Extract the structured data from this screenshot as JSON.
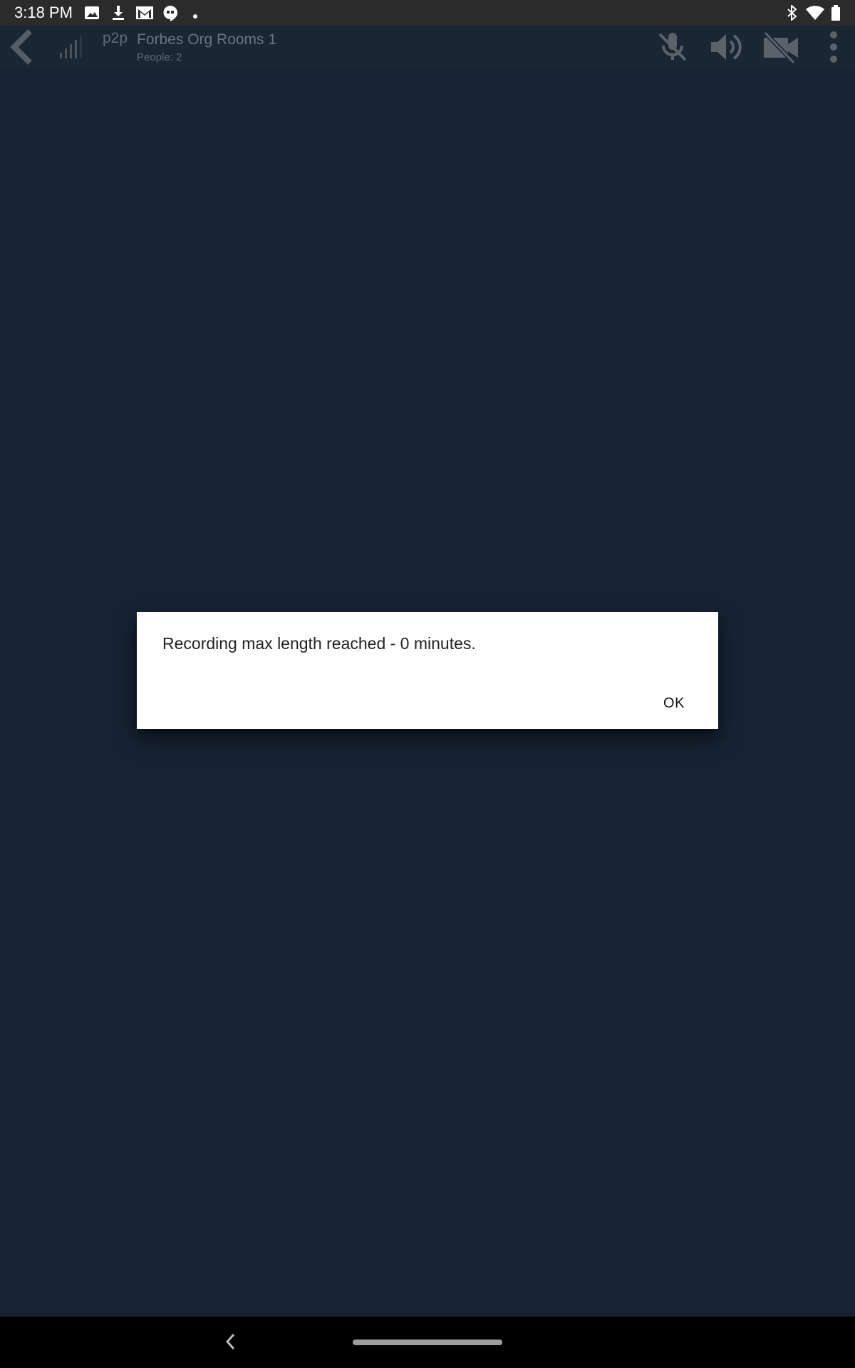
{
  "status_bar": {
    "time": "3:18 PM",
    "left_icons": [
      "image-icon",
      "download-icon",
      "gmail-icon",
      "hangouts-icon",
      "dot-icon"
    ],
    "right_icons": [
      "bluetooth-icon",
      "wifi-icon",
      "battery-icon"
    ]
  },
  "app_bar": {
    "back_icon": "chevron-left-icon",
    "signal_icon": "signal-bars-icon",
    "mode_label": "p2p",
    "room_title": "Forbes Org Rooms 1",
    "people_count": "People: 2",
    "actions": [
      "mic-off-icon",
      "speaker-icon",
      "video-off-icon",
      "more-vert-icon"
    ],
    "dimmed_color": "#6b737d"
  },
  "dialog": {
    "message": "Recording max length reached - 0 minutes.",
    "ok_label": "OK"
  },
  "nav_bar": {
    "back_icon": "nav-back-icon",
    "home_icon": "home-pill-icon"
  },
  "colors": {
    "background": "#172333",
    "status_bar": "#2b2b2b",
    "dialog_bg": "#ffffff",
    "nav_bar": "#000000"
  }
}
